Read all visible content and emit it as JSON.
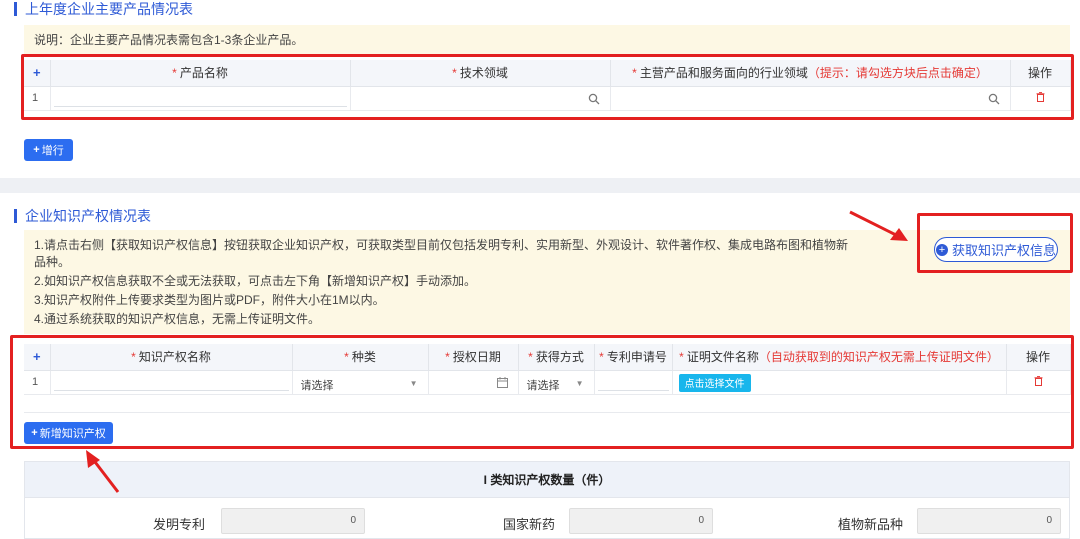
{
  "section1": {
    "title": "上年度企业主要产品情况表",
    "note": "说明：企业主要产品情况表需包含1-3条企业产品。",
    "headers": {
      "add": "+",
      "product_name": "产品名称",
      "tech_field": "技术领域",
      "industry": "主营产品和服务面向的行业领域",
      "industry_hint": "（提示：请勾选方块后点击确定）",
      "action": "操作"
    },
    "rows": [
      {
        "index": "1"
      }
    ],
    "add_row_button": "增行"
  },
  "section2": {
    "title": "企业知识产权情况表",
    "fetch_button": "获取知识产权信息",
    "notes": [
      "1.请点击右侧【获取知识产权信息】按钮获取企业知识产权，可获取类型目前仅包括发明专利、实用新型、外观设计、软件著作权、集成电路布图和植物新品种。",
      "2.如知识产权信息获取不全或无法获取，可点击左下角【新增知识产权】手动添加。",
      "3.知识产权附件上传要求类型为图片或PDF，附件大小在1M以内。",
      "4.通过系统获取的知识产权信息，无需上传证明文件。"
    ],
    "headers": {
      "add": "+",
      "ip_name": "知识产权名称",
      "type": "种类",
      "grant_date": "授权日期",
      "acquire_method": "获得方式",
      "patent_no": "专利申请号",
      "cert_file": "证明文件名称",
      "cert_hint": "（自动获取到的知识产权无需上传证明文件）",
      "action": "操作"
    },
    "rows": [
      {
        "index": "1",
        "type_value": "请选择",
        "acquire_value": "请选择",
        "file_button": "点击选择文件"
      }
    ],
    "add_ip_button": "新增知识产权"
  },
  "stats": {
    "title": "I 类知识产权数量（件）",
    "items": [
      {
        "label": "发明专利",
        "value": "0"
      },
      {
        "label": "国家新药",
        "value": "0"
      },
      {
        "label": "植物新品种",
        "value": "0"
      }
    ]
  },
  "colors": {
    "accent": "#2e5ad6",
    "annotation_red": "#e32020",
    "note_bg": "#fdf8e4"
  }
}
